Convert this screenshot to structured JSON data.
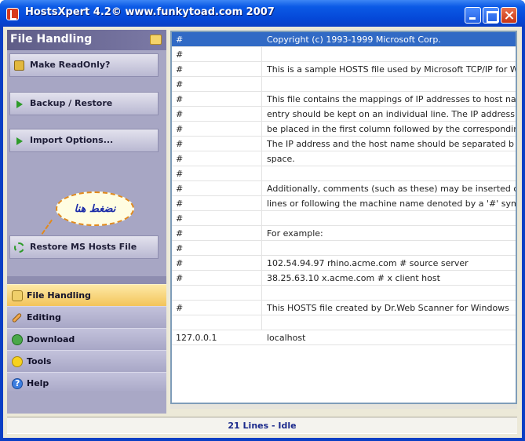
{
  "window": {
    "title": "HostsXpert 4.2© www.funkytoad.com 2007"
  },
  "sidebar": {
    "panel_title": "File Handling",
    "tasks": [
      {
        "label": "Make ReadOnly?",
        "icon": "lock-icon"
      },
      {
        "label": "Backup / Restore",
        "icon": "arrow-right-icon"
      },
      {
        "label": "Import Options...",
        "icon": "arrow-right-icon"
      },
      {
        "label": "Restore MS Hosts File",
        "icon": "recycle-icon"
      }
    ],
    "callout": "نضغط هنا",
    "nav": [
      {
        "label": "File Handling",
        "icon": "file-handling-icon",
        "active": true
      },
      {
        "label": "Editing",
        "icon": "pencil-icon"
      },
      {
        "label": "Download",
        "icon": "download-icon"
      },
      {
        "label": "Tools",
        "icon": "tools-icon"
      },
      {
        "label": "Help",
        "icon": "help-icon"
      }
    ]
  },
  "hosts_rows": [
    {
      "c1": "#",
      "c2": "Copyright (c) 1993-1999 Microsoft Corp.",
      "selected": true
    },
    {
      "c1": "#",
      "c2": ""
    },
    {
      "c1": "#",
      "c2": "This is a sample HOSTS file used by Microsoft TCP/IP for W"
    },
    {
      "c1": "#",
      "c2": ""
    },
    {
      "c1": "#",
      "c2": "This file contains the mappings of IP addresses to host na"
    },
    {
      "c1": "#",
      "c2": "entry should be kept on an individual line. The IP address"
    },
    {
      "c1": "#",
      "c2": "be placed in the first column followed by the corresponding"
    },
    {
      "c1": "#",
      "c2": "The IP address and the host name should be separated b"
    },
    {
      "c1": "#",
      "c2": "space."
    },
    {
      "c1": "#",
      "c2": ""
    },
    {
      "c1": "#",
      "c2": "Additionally, comments (such as these) may be inserted o"
    },
    {
      "c1": "#",
      "c2": "lines or following the machine name denoted by a '#' symb"
    },
    {
      "c1": "#",
      "c2": ""
    },
    {
      "c1": "#",
      "c2": "For example:"
    },
    {
      "c1": "#",
      "c2": ""
    },
    {
      "c1": "#",
      "c2": "102.54.94.97     rhino.acme.com          # source server"
    },
    {
      "c1": "#",
      "c2": "38.25.63.10     x.acme.com              # x client host"
    },
    {
      "c1": "",
      "c2": ""
    },
    {
      "c1": "#",
      "c2": "This HOSTS file created by Dr.Web Scanner for Windows"
    },
    {
      "c1": "",
      "c2": ""
    },
    {
      "c1": "127.0.0.1",
      "c2": "localhost"
    }
  ],
  "status": {
    "text": "21 Lines - Idle"
  }
}
